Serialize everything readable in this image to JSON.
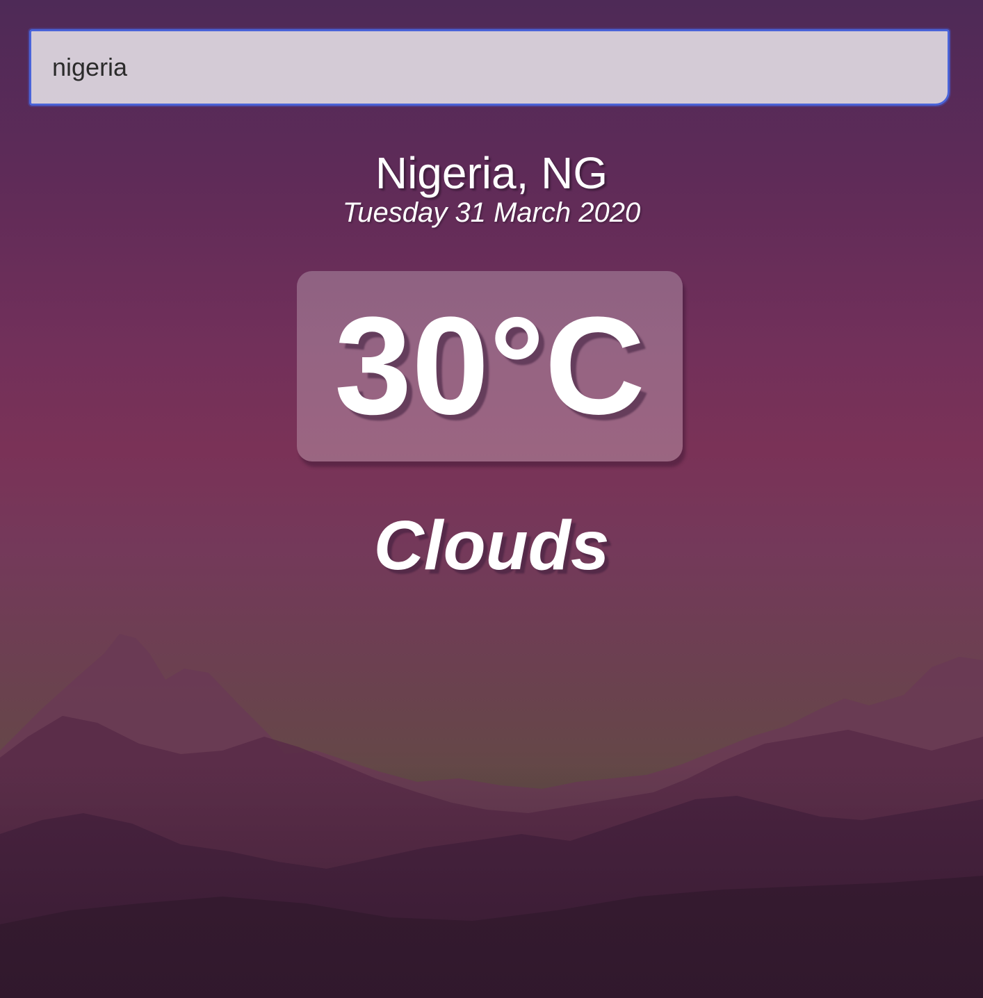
{
  "search": {
    "value": "nigeria",
    "placeholder": "Search..."
  },
  "location": {
    "name": "Nigeria, NG",
    "date": "Tuesday 31 March 2020"
  },
  "weather": {
    "temperature": "30°C",
    "condition": "Clouds"
  },
  "background": {
    "icon": "mountains-landscape",
    "top_color": "#4e2a57",
    "mid_color": "#7a3257",
    "bottom_color": "#2a1628"
  }
}
